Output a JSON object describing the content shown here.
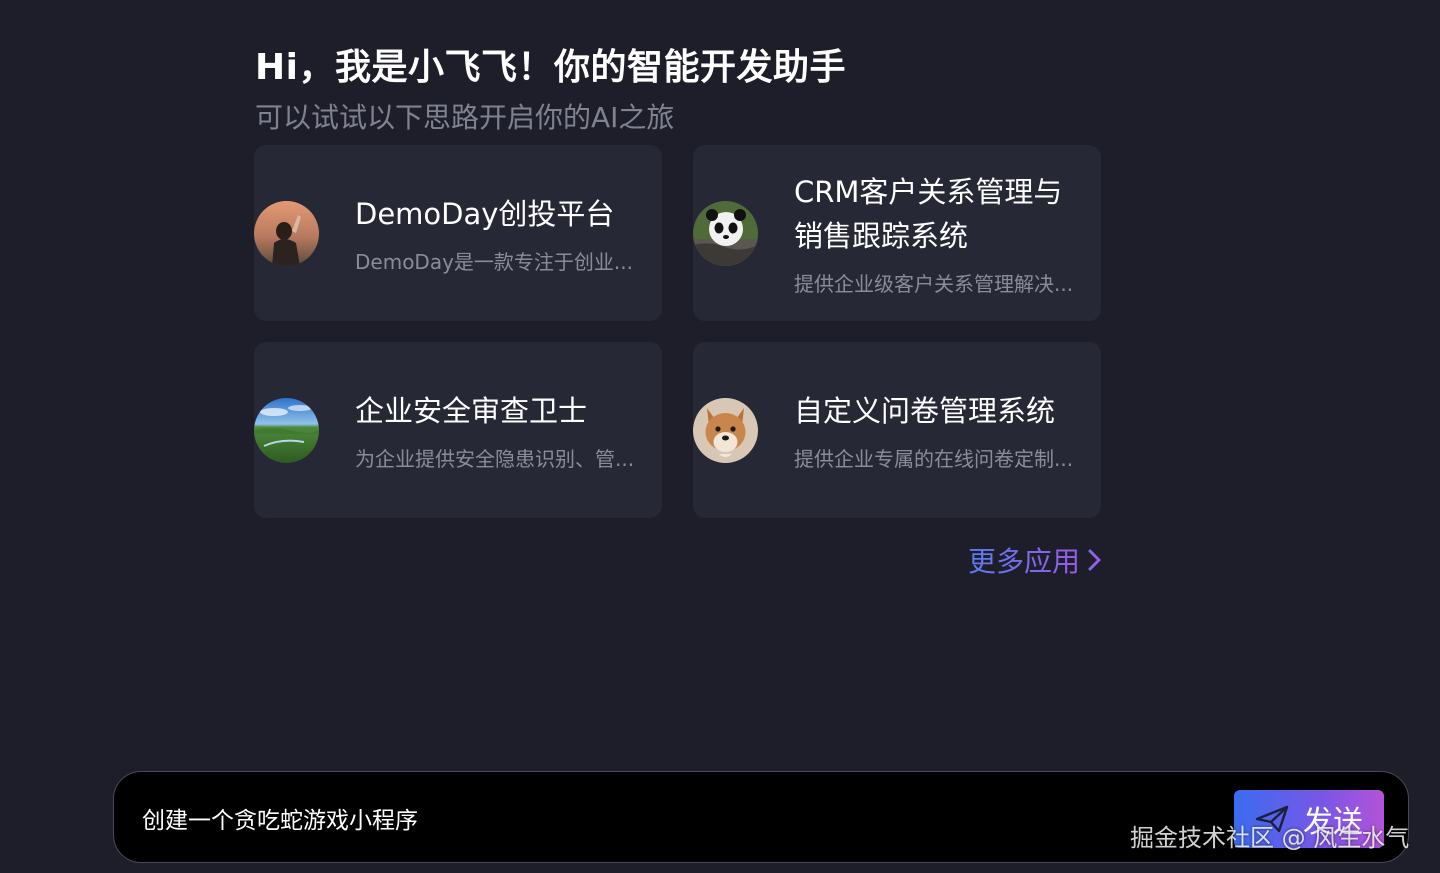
{
  "header": {
    "greeting": "Hi，我是小飞飞！你的智能开发助手",
    "subtitle": "可以试试以下思路开启你的AI之旅"
  },
  "apps": [
    {
      "title": "DemoDay创投平台",
      "description": "DemoDay是一款专注于创业...",
      "avatar": "person-photo-avatar"
    },
    {
      "title": "CRM客户关系管理与销售跟踪系统",
      "description": "提供企业级客户关系管理解决...",
      "avatar": "panda-photo-avatar"
    },
    {
      "title": "企业安全审查卫士",
      "description": "为企业提供安全隐患识别、管...",
      "avatar": "landscape-photo-avatar"
    },
    {
      "title": "自定义问卷管理系统",
      "description": "提供企业专属的在线问卷定制...",
      "avatar": "shiba-dog-photo-avatar"
    }
  ],
  "more_apps": {
    "label": "更多应用",
    "icon": "chevron-right-icon"
  },
  "input": {
    "value": "创建一个贪吃蛇游戏小程序",
    "send_label": "发送",
    "send_icon": "paper-plane-icon"
  },
  "watermark": "掘金技术社区 @ 风生水气",
  "colors": {
    "background": "#1e1e2b",
    "card": "#262835",
    "accent_gradient_start": "#3a6cf0",
    "accent_gradient_end": "#b354d8"
  }
}
